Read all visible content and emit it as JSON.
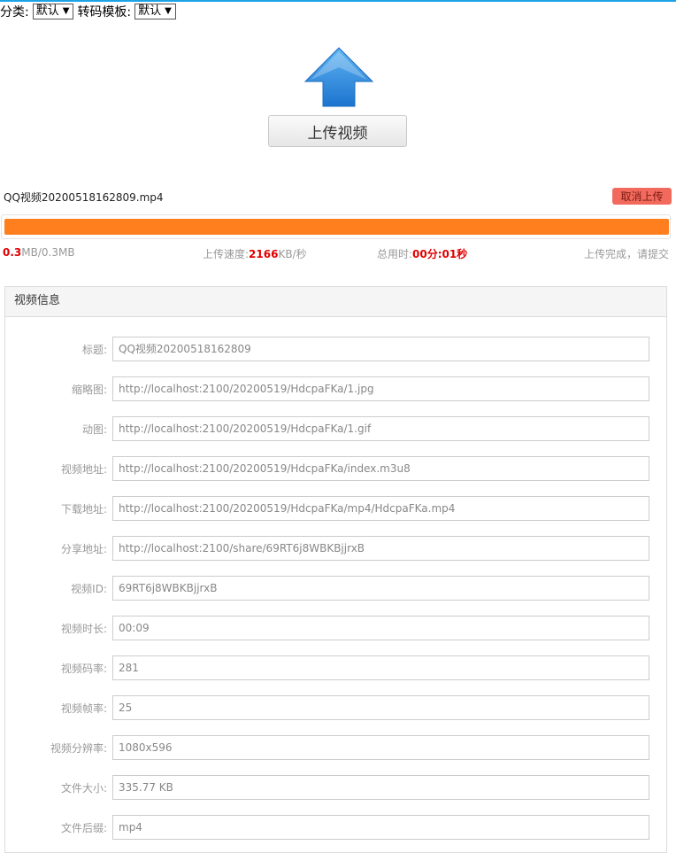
{
  "filters": {
    "category_label": "分类:",
    "category_value": "默认",
    "template_label": "转码模板:",
    "template_value": "默认",
    "caret": "▼"
  },
  "upload": {
    "button_label": "上传视频"
  },
  "file": {
    "name": "QQ视频20200518162809.mp4",
    "cancel_label": "取消上传",
    "progress_percent": 100
  },
  "stats": {
    "size_uploaded": "0.3",
    "size_rest": "MB/0.3MB",
    "speed_label": "上传速度:",
    "speed_value": "2166",
    "speed_unit": "KB/秒",
    "time_label": "总用时:",
    "time_value": "00分:01秒",
    "status": "上传完成，请提交"
  },
  "colors": {
    "accent_bar": "#1aa3e8",
    "progress": "#ff7f1f",
    "cancel": "#f26a5e",
    "highlight": "#e00000"
  },
  "panel": {
    "title": "视频信息",
    "fields": [
      {
        "label": "标题:",
        "value": "QQ视频20200518162809"
      },
      {
        "label": "缩略图:",
        "value": "http://localhost:2100/20200519/HdcpaFKa/1.jpg"
      },
      {
        "label": "动图:",
        "value": "http://localhost:2100/20200519/HdcpaFKa/1.gif"
      },
      {
        "label": "视频地址:",
        "value": "http://localhost:2100/20200519/HdcpaFKa/index.m3u8"
      },
      {
        "label": "下载地址:",
        "value": "http://localhost:2100/20200519/HdcpaFKa/mp4/HdcpaFKa.mp4"
      },
      {
        "label": "分享地址:",
        "value": "http://localhost:2100/share/69RT6j8WBKBjjrxB"
      },
      {
        "label": "视频ID:",
        "value": "69RT6j8WBKBjjrxB"
      },
      {
        "label": "视频时长:",
        "value": "00:09"
      },
      {
        "label": "视频码率:",
        "value": "281"
      },
      {
        "label": "视频帧率:",
        "value": "25"
      },
      {
        "label": "视频分辨率:",
        "value": "1080x596"
      },
      {
        "label": "文件大小:",
        "value": "335.77 KB"
      },
      {
        "label": "文件后缀:",
        "value": "mp4"
      }
    ]
  }
}
